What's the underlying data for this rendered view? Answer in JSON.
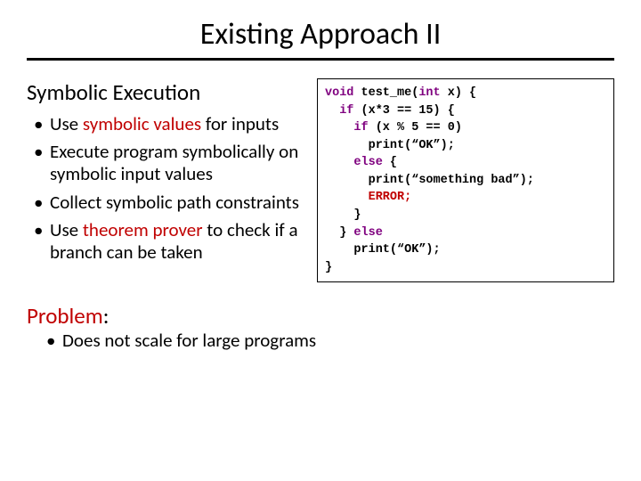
{
  "title": "Existing Approach II",
  "subhead": "Symbolic Execution",
  "bullets": {
    "b1_pre": "Use ",
    "b1_kw": "symbolic values",
    "b1_post": " for inputs",
    "b2": "Execute program symbolically on symbolic input values",
    "b3": "Collect symbolic path constraints",
    "b4_pre": "Use ",
    "b4_kw": "theorem prover",
    "b4_post": " to check if a branch can be taken"
  },
  "code": {
    "l1a": "void",
    "l1b": " test_me(",
    "l1c": "int",
    "l1d": " x) {",
    "l2a": "  if",
    "l2b": " (x*3 == 15) {",
    "l3a": "    if",
    "l3b": " (x % 5 == 0)",
    "l4": "      print(“OK”);",
    "l5a": "    else",
    "l5b": " {",
    "l6": "      print(“something bad”);",
    "l7": "      ERROR;",
    "l8": "    }",
    "l9a": "  } ",
    "l9b": "else",
    "l10": "    print(“OK”);",
    "l11": "}"
  },
  "problem": {
    "head": "Problem",
    "colon": ":",
    "b1": "Does not scale for large programs"
  }
}
